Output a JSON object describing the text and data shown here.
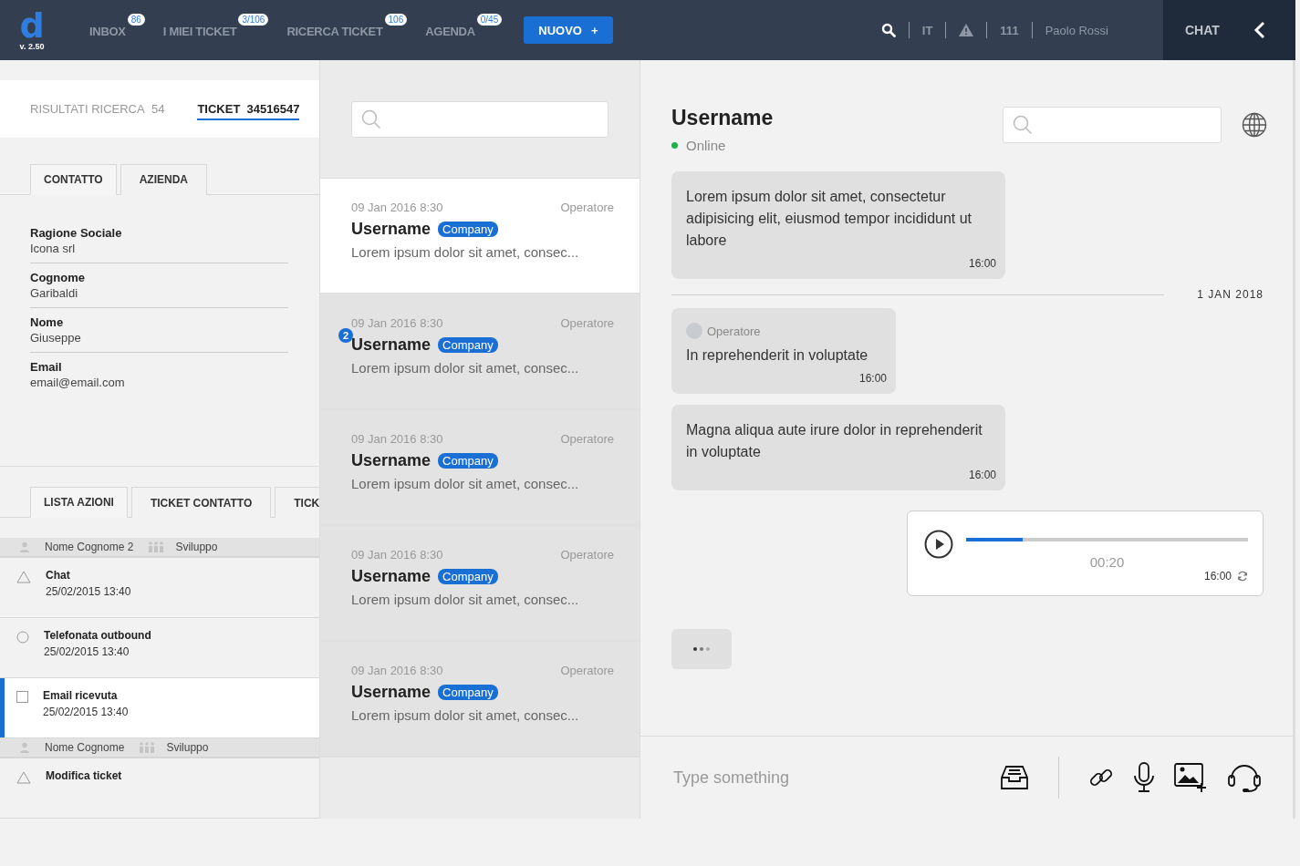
{
  "header": {
    "logo": "d",
    "version": "v. 2.50",
    "nav": [
      {
        "label": "INBOX",
        "badge": "86"
      },
      {
        "label": "I MIEI TICKET",
        "badge": "3/106"
      },
      {
        "label": "RICERCA TICKET",
        "badge": "106"
      },
      {
        "label": "AGENDA",
        "badge": "0/45"
      }
    ],
    "new_button": "NUOVO",
    "new_icon": "+",
    "language": "IT",
    "extension": "111",
    "user": "Paolo Rossi",
    "chat_label": "CHAT"
  },
  "left": {
    "top_tabs": [
      {
        "label": "RISULTATI RICERCA",
        "count": "54",
        "selected": false
      },
      {
        "label": "TICKET",
        "count": "34516547",
        "selected": true
      }
    ],
    "contact_tabs": [
      {
        "label": "CONTATTO",
        "selected": true
      },
      {
        "label": "AZIENDA",
        "selected": false
      }
    ],
    "fields": [
      {
        "label": "Ragione Sociale",
        "value": "Icona srl"
      },
      {
        "label": "Cognome",
        "value": "Garibaldi"
      },
      {
        "label": "Nome",
        "value": "Giuseppe"
      },
      {
        "label": "Email",
        "value": "email@email.com"
      }
    ],
    "action_tabs": [
      {
        "label": "LISTA AZIONI",
        "selected": true
      },
      {
        "label": "TICKET CONTATTO",
        "selected": false
      },
      {
        "label": "TICK",
        "selected": false
      }
    ],
    "action_groups": [
      {
        "user": "Nome Cognome 2",
        "team": "Sviluppo",
        "items": [
          {
            "kind": "triangle",
            "title": "Chat",
            "time": "25/02/2015 13:40",
            "selected": false
          },
          {
            "kind": "circle",
            "title": "Telefonata outbound",
            "time": "25/02/2015 13:40",
            "selected": false
          },
          {
            "kind": "square",
            "title": "Email ricevuta",
            "time": "25/02/2015 13:40",
            "selected": true
          }
        ]
      },
      {
        "user": "Nome Cognome",
        "team": "Sviluppo",
        "items": [
          {
            "kind": "triangle",
            "title": "Modifica ticket",
            "selected": false
          }
        ]
      }
    ]
  },
  "conversations": [
    {
      "date": "09 Jan 2016 8:30",
      "operator": "Operatore",
      "name": "Username",
      "tag": "Company",
      "preview": "Lorem ipsum dolor sit amet, consec...",
      "selected": true
    },
    {
      "date": "09 Jan 2016 8:30",
      "operator": "Operatore",
      "name": "Username",
      "tag": "Company",
      "preview": "Lorem ipsum dolor sit amet, consec...",
      "unread": "2",
      "selected": false
    },
    {
      "date": "09 Jan 2016 8:30",
      "operator": "Operatore",
      "name": "Username",
      "tag": "Company",
      "preview": "Lorem ipsum dolor sit amet, consec...",
      "selected": false
    },
    {
      "date": "09 Jan 2016 8:30",
      "operator": "Operatore",
      "name": "Username",
      "tag": "Company",
      "preview": "Lorem ipsum dolor sit amet, consec...",
      "selected": false
    },
    {
      "date": "09 Jan 2016 8:30",
      "operator": "Operatore",
      "name": "Username",
      "tag": "Company",
      "preview": "Lorem ipsum dolor sit amet, consec...",
      "selected": false
    }
  ],
  "chat": {
    "name": "Username",
    "status": "Online",
    "online": true,
    "messages": [
      {
        "kind": "text",
        "text": "Lorem ipsum dolor sit amet, consectetur adipisicing elit, eiusmod tempor incididunt ut labore",
        "time": "16:00"
      },
      {
        "kind": "divider",
        "text": "1 JAN 2018"
      },
      {
        "kind": "text",
        "author": "Operatore",
        "text": "In reprehenderit in voluptate",
        "time": "16:00"
      },
      {
        "kind": "text",
        "text": "Magna aliqua aute irure dolor in reprehenderit in voluptate",
        "time": "16:00"
      },
      {
        "kind": "audio",
        "level": 0.2,
        "duration": "00:20",
        "time": "16:00"
      },
      {
        "kind": "typing"
      }
    ],
    "input": {
      "placeholder": "Type something"
    }
  }
}
